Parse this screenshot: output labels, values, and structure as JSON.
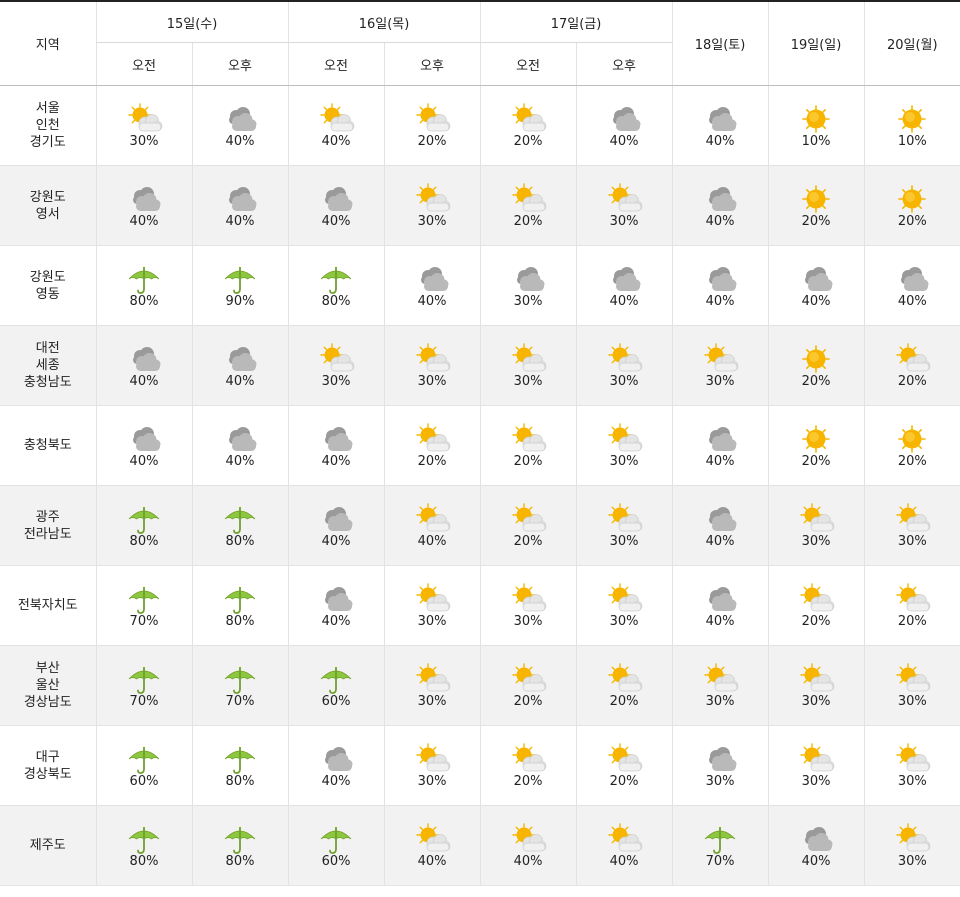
{
  "header": {
    "region_label": "지역",
    "days": [
      {
        "label": "15일(수)",
        "halves": [
          "오전",
          "오후"
        ]
      },
      {
        "label": "16일(목)",
        "halves": [
          "오전",
          "오후"
        ]
      },
      {
        "label": "17일(금)",
        "halves": [
          "오전",
          "오후"
        ]
      },
      {
        "label": "18일(토)",
        "halves": []
      },
      {
        "label": "19일(일)",
        "halves": []
      },
      {
        "label": "20일(월)",
        "halves": []
      }
    ]
  },
  "rows": [
    {
      "region": [
        "서울",
        "인천",
        "경기도"
      ],
      "shaded": false,
      "cells": [
        {
          "icon": "partly-cloudy-icon",
          "pct": "30%"
        },
        {
          "icon": "cloudy-icon",
          "pct": "40%"
        },
        {
          "icon": "partly-cloudy-icon",
          "pct": "40%"
        },
        {
          "icon": "partly-cloudy-icon",
          "pct": "20%"
        },
        {
          "icon": "partly-cloudy-icon",
          "pct": "20%"
        },
        {
          "icon": "cloudy-icon",
          "pct": "40%"
        },
        {
          "icon": "cloudy-icon",
          "pct": "40%"
        },
        {
          "icon": "sunny-icon",
          "pct": "10%"
        },
        {
          "icon": "sunny-icon",
          "pct": "10%"
        }
      ]
    },
    {
      "region": [
        "강원도",
        "영서"
      ],
      "shaded": true,
      "cells": [
        {
          "icon": "cloudy-icon",
          "pct": "40%"
        },
        {
          "icon": "cloudy-icon",
          "pct": "40%"
        },
        {
          "icon": "cloudy-icon",
          "pct": "40%"
        },
        {
          "icon": "partly-cloudy-icon",
          "pct": "30%"
        },
        {
          "icon": "partly-cloudy-icon",
          "pct": "20%"
        },
        {
          "icon": "partly-cloudy-icon",
          "pct": "30%"
        },
        {
          "icon": "cloudy-icon",
          "pct": "40%"
        },
        {
          "icon": "sunny-icon",
          "pct": "20%"
        },
        {
          "icon": "sunny-icon",
          "pct": "20%"
        }
      ]
    },
    {
      "region": [
        "강원도",
        "영동"
      ],
      "shaded": false,
      "cells": [
        {
          "icon": "umbrella-icon",
          "pct": "80%"
        },
        {
          "icon": "umbrella-icon",
          "pct": "90%"
        },
        {
          "icon": "umbrella-icon",
          "pct": "80%"
        },
        {
          "icon": "cloudy-icon",
          "pct": "40%"
        },
        {
          "icon": "cloudy-icon",
          "pct": "30%"
        },
        {
          "icon": "cloudy-icon",
          "pct": "40%"
        },
        {
          "icon": "cloudy-icon",
          "pct": "40%"
        },
        {
          "icon": "cloudy-icon",
          "pct": "40%"
        },
        {
          "icon": "cloudy-icon",
          "pct": "40%"
        }
      ]
    },
    {
      "region": [
        "대전",
        "세종",
        "충청남도"
      ],
      "shaded": true,
      "cells": [
        {
          "icon": "cloudy-icon",
          "pct": "40%"
        },
        {
          "icon": "cloudy-icon",
          "pct": "40%"
        },
        {
          "icon": "partly-cloudy-icon",
          "pct": "30%"
        },
        {
          "icon": "partly-cloudy-icon",
          "pct": "30%"
        },
        {
          "icon": "partly-cloudy-icon",
          "pct": "30%"
        },
        {
          "icon": "partly-cloudy-icon",
          "pct": "30%"
        },
        {
          "icon": "partly-cloudy-icon",
          "pct": "30%"
        },
        {
          "icon": "sunny-icon",
          "pct": "20%"
        },
        {
          "icon": "partly-cloudy-icon",
          "pct": "20%"
        }
      ]
    },
    {
      "region": [
        "충청북도"
      ],
      "shaded": false,
      "cells": [
        {
          "icon": "cloudy-icon",
          "pct": "40%"
        },
        {
          "icon": "cloudy-icon",
          "pct": "40%"
        },
        {
          "icon": "cloudy-icon",
          "pct": "40%"
        },
        {
          "icon": "partly-cloudy-icon",
          "pct": "20%"
        },
        {
          "icon": "partly-cloudy-icon",
          "pct": "20%"
        },
        {
          "icon": "partly-cloudy-icon",
          "pct": "30%"
        },
        {
          "icon": "cloudy-icon",
          "pct": "40%"
        },
        {
          "icon": "sunny-icon",
          "pct": "20%"
        },
        {
          "icon": "sunny-icon",
          "pct": "20%"
        }
      ]
    },
    {
      "region": [
        "광주",
        "전라남도"
      ],
      "shaded": true,
      "cells": [
        {
          "icon": "umbrella-icon",
          "pct": "80%"
        },
        {
          "icon": "umbrella-icon",
          "pct": "80%"
        },
        {
          "icon": "cloudy-icon",
          "pct": "40%"
        },
        {
          "icon": "partly-cloudy-icon",
          "pct": "40%"
        },
        {
          "icon": "partly-cloudy-icon",
          "pct": "20%"
        },
        {
          "icon": "partly-cloudy-icon",
          "pct": "30%"
        },
        {
          "icon": "cloudy-icon",
          "pct": "40%"
        },
        {
          "icon": "partly-cloudy-icon",
          "pct": "30%"
        },
        {
          "icon": "partly-cloudy-icon",
          "pct": "30%"
        }
      ]
    },
    {
      "region": [
        "전북자치도"
      ],
      "shaded": false,
      "cells": [
        {
          "icon": "umbrella-icon",
          "pct": "70%"
        },
        {
          "icon": "umbrella-icon",
          "pct": "80%"
        },
        {
          "icon": "cloudy-icon",
          "pct": "40%"
        },
        {
          "icon": "partly-cloudy-icon",
          "pct": "30%"
        },
        {
          "icon": "partly-cloudy-icon",
          "pct": "30%"
        },
        {
          "icon": "partly-cloudy-icon",
          "pct": "30%"
        },
        {
          "icon": "cloudy-icon",
          "pct": "40%"
        },
        {
          "icon": "partly-cloudy-icon",
          "pct": "20%"
        },
        {
          "icon": "partly-cloudy-icon",
          "pct": "20%"
        }
      ]
    },
    {
      "region": [
        "부산",
        "울산",
        "경상남도"
      ],
      "shaded": true,
      "cells": [
        {
          "icon": "umbrella-icon",
          "pct": "70%"
        },
        {
          "icon": "umbrella-icon",
          "pct": "70%"
        },
        {
          "icon": "umbrella-icon",
          "pct": "60%"
        },
        {
          "icon": "partly-cloudy-icon",
          "pct": "30%"
        },
        {
          "icon": "partly-cloudy-icon",
          "pct": "20%"
        },
        {
          "icon": "partly-cloudy-icon",
          "pct": "20%"
        },
        {
          "icon": "partly-cloudy-icon",
          "pct": "30%"
        },
        {
          "icon": "partly-cloudy-icon",
          "pct": "30%"
        },
        {
          "icon": "partly-cloudy-icon",
          "pct": "30%"
        }
      ]
    },
    {
      "region": [
        "대구",
        "경상북도"
      ],
      "shaded": false,
      "cells": [
        {
          "icon": "umbrella-icon",
          "pct": "60%"
        },
        {
          "icon": "umbrella-icon",
          "pct": "80%"
        },
        {
          "icon": "cloudy-icon",
          "pct": "40%"
        },
        {
          "icon": "partly-cloudy-icon",
          "pct": "30%"
        },
        {
          "icon": "partly-cloudy-icon",
          "pct": "20%"
        },
        {
          "icon": "partly-cloudy-icon",
          "pct": "20%"
        },
        {
          "icon": "cloudy-icon",
          "pct": "30%"
        },
        {
          "icon": "partly-cloudy-icon",
          "pct": "30%"
        },
        {
          "icon": "partly-cloudy-icon",
          "pct": "30%"
        }
      ]
    },
    {
      "region": [
        "제주도"
      ],
      "shaded": true,
      "cells": [
        {
          "icon": "umbrella-icon",
          "pct": "80%"
        },
        {
          "icon": "umbrella-icon",
          "pct": "80%"
        },
        {
          "icon": "umbrella-icon",
          "pct": "60%"
        },
        {
          "icon": "partly-cloudy-icon",
          "pct": "40%"
        },
        {
          "icon": "partly-cloudy-icon",
          "pct": "40%"
        },
        {
          "icon": "partly-cloudy-icon",
          "pct": "40%"
        },
        {
          "icon": "umbrella-icon",
          "pct": "70%"
        },
        {
          "icon": "cloudy-icon",
          "pct": "40%"
        },
        {
          "icon": "partly-cloudy-icon",
          "pct": "30%"
        }
      ]
    }
  ],
  "colors": {
    "header_rule": "#222222",
    "row_shade": "#f2f2f2",
    "sun": "#f7b500",
    "cloud": "#b9b9b9",
    "umbrella": "#8dc63f"
  }
}
